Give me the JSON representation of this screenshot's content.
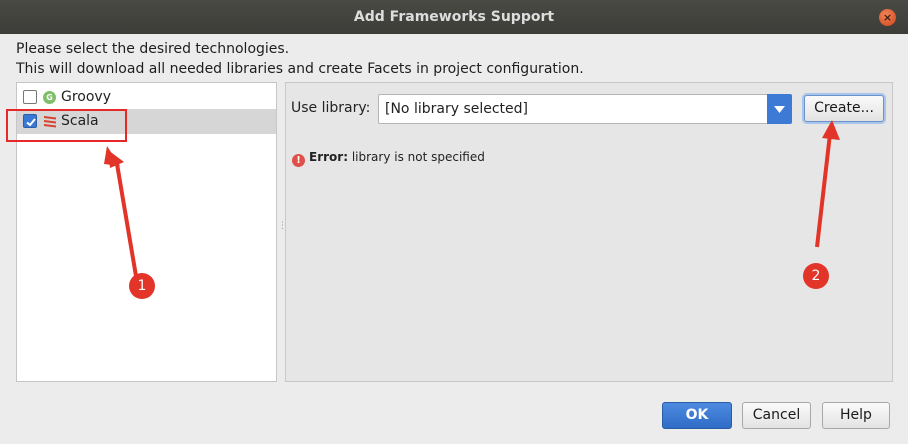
{
  "window": {
    "title": "Add Frameworks Support",
    "close_glyph": "×"
  },
  "description": {
    "line1": "Please select the desired technologies.",
    "line2": "This will download all needed libraries and create Facets in project configuration."
  },
  "technologies": [
    {
      "label": "Groovy",
      "checked": false,
      "icon": "groovy-icon"
    },
    {
      "label": "Scala",
      "checked": true,
      "icon": "scala-icon",
      "selected": true
    }
  ],
  "config": {
    "use_library_label": "Use library:",
    "library_value": "[No library selected]",
    "create_label": "Create...",
    "error_prefix": "Error:",
    "error_text": "library is not specified"
  },
  "footer": {
    "ok_label": "OK",
    "cancel_label": "Cancel",
    "help_label": "Help"
  },
  "annotations": {
    "badge1": "1",
    "badge2": "2",
    "color": "#e62828"
  },
  "colors": {
    "accent": "#3a78d5",
    "selection": "#d6d6d6",
    "error": "#e0504a"
  }
}
